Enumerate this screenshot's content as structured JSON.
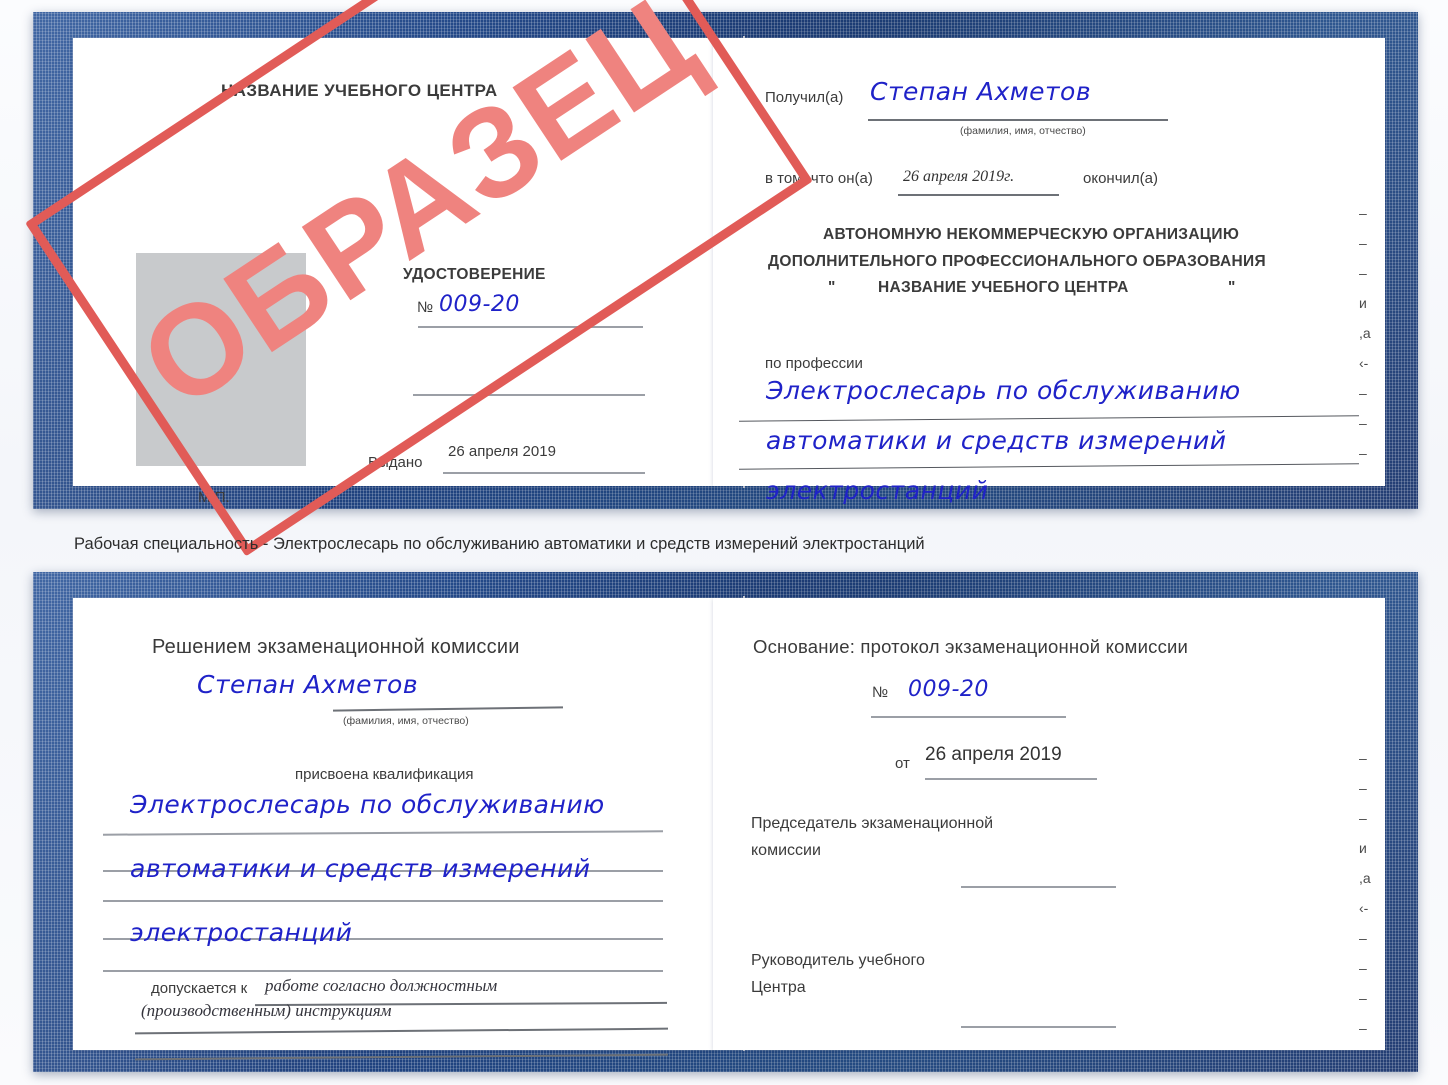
{
  "document": {
    "type": "Удостоверение",
    "watermark": "ОБРАЗЕЦ",
    "accent_blue": "#224a8c",
    "handwriting_blue": "#1f22c8",
    "stamp_red": "#e15b57"
  },
  "caption": {
    "text": "Рабочая специальность - Электрослесарь по обслуживанию автоматики и средств измерений электростанций"
  },
  "certificate_top": {
    "left_page": {
      "center_title": "НАЗВАНИЕ УЧЕБНОГО ЦЕНТРА",
      "doc_type": "УДОСТОВЕРЕНИЕ",
      "number_label": "№",
      "number_value": "009-20",
      "issued_label": "Выдано",
      "issued_value": "26 апреля 2019",
      "seal_label": "М.П.",
      "photo_placeholder": "photo-box"
    },
    "right_page": {
      "received_label": "Получил(а)",
      "received_value": "Степан Ахметов",
      "received_hint": "(фамилия, имя, отчество)",
      "in_that_label": "в том, что он(а)",
      "in_that_value": "26 апреля 2019г.",
      "finished_label": "окончил(а)",
      "org_line1": "АВТОНОМНУЮ НЕКОММЕРЧЕСКУЮ ОРГАНИЗАЦИЮ",
      "org_line2": "ДОПОЛНИТЕЛЬНОГО ПРОФЕССИОНАЛЬНОГО ОБРАЗОВАНИЯ",
      "org_quote_open": "\"",
      "org_line3": "НАЗВАНИЕ УЧЕБНОГО ЦЕНТРА",
      "org_quote_close": "\"",
      "profession_label": "по профессии",
      "profession_line1": "Электрослесарь по обслуживанию",
      "profession_line2": "автоматики и средств измерений",
      "profession_line3": "электростанций",
      "edge_bleed": [
        "–",
        "–",
        "–",
        "и",
        ",а",
        "‹-",
        "–",
        "–",
        "–"
      ]
    }
  },
  "certificate_bottom": {
    "left_page": {
      "title": "Решением экзаменационной комиссии",
      "name_value": "Степан Ахметов",
      "name_hint": "(фамилия, имя, отчество)",
      "qualification_label": "присвоена квалификация",
      "qualification_line1": "Электрослесарь по обслуживанию",
      "qualification_line2": "автоматики и средств измерений",
      "qualification_line3": "электростанций",
      "admitted_label": "допускается к",
      "admitted_value_line1": "работе согласно должностным",
      "admitted_value_line2": "(производственным) инструкциям"
    },
    "right_page": {
      "basis_label": "Основание: протокол экзаменационной комиссии",
      "number_label": "№",
      "number_value": "009-20",
      "date_label": "от",
      "date_value": "26 апреля 2019",
      "chairman_line1": "Председатель экзаменационной",
      "chairman_line2": "комиссии",
      "head_line1": "Руководитель учебного",
      "head_line2": "Центра",
      "edge_bleed": [
        "–",
        "–",
        "–",
        "и",
        ",а",
        "‹-",
        "–",
        "–",
        "–",
        "–"
      ]
    }
  }
}
